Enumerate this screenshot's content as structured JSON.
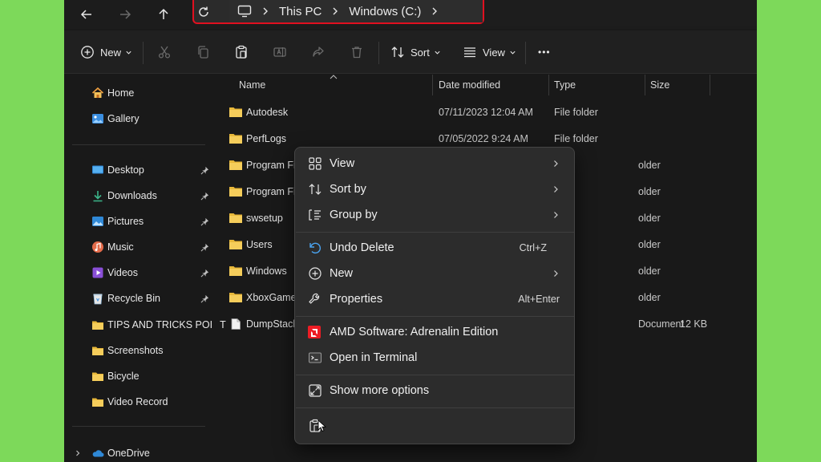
{
  "address": {
    "crumbs": [
      "This PC",
      "Windows (C:)"
    ]
  },
  "toolbar": {
    "new_label": "New",
    "sort_label": "Sort",
    "view_label": "View",
    "more_label": "•••"
  },
  "nav": {
    "items": [
      {
        "label": "Home",
        "icon": "home-icon"
      },
      {
        "label": "Gallery",
        "icon": "gallery-icon"
      },
      {
        "label": "Desktop",
        "icon": "desktop-icon",
        "pinned": true
      },
      {
        "label": "Downloads",
        "icon": "download-icon",
        "pinned": true
      },
      {
        "label": "Pictures",
        "icon": "pictures-icon",
        "pinned": true
      },
      {
        "label": "Music",
        "icon": "music-icon",
        "pinned": true
      },
      {
        "label": "Videos",
        "icon": "videos-icon",
        "pinned": true
      },
      {
        "label": "Recycle Bin",
        "icon": "recycle-bin-icon",
        "pinned": true
      },
      {
        "label": "TIPS AND TRICKS POINT",
        "icon": "folder-icon"
      },
      {
        "label": "Screenshots",
        "icon": "folder-icon"
      },
      {
        "label": "Bicycle",
        "icon": "folder-icon"
      },
      {
        "label": "Video Record",
        "icon": "folder-icon"
      },
      {
        "label": "OneDrive",
        "icon": "onedrive-icon"
      }
    ]
  },
  "columns": {
    "name": "Name",
    "date": "Date modified",
    "type": "Type",
    "size": "Size"
  },
  "files": [
    {
      "name": "Autodesk",
      "date": "07/11/2023 12:04 AM",
      "type": "File folder",
      "size": ""
    },
    {
      "name": "PerfLogs",
      "date": "07/05/2022 9:24 AM",
      "type": "File folder",
      "size": ""
    },
    {
      "name": "Program Fil",
      "date": "",
      "type": "older",
      "size": ""
    },
    {
      "name": "Program Fil",
      "date": "",
      "type": "older",
      "size": ""
    },
    {
      "name": "swsetup",
      "date": "",
      "type": "older",
      "size": ""
    },
    {
      "name": "Users",
      "date": "",
      "type": "older",
      "size": ""
    },
    {
      "name": "Windows",
      "date": "",
      "type": "older",
      "size": ""
    },
    {
      "name": "XboxGames",
      "date": "",
      "type": "older",
      "size": ""
    },
    {
      "name": "DumpStack",
      "date": "",
      "type": "Document",
      "size": "12 KB"
    }
  ],
  "context_menu": {
    "view": "View",
    "sort_by": "Sort by",
    "group_by": "Group by",
    "undo_delete": "Undo Delete",
    "undo_shortcut": "Ctrl+Z",
    "new": "New",
    "properties": "Properties",
    "properties_shortcut": "Alt+Enter",
    "amd": "AMD Software: Adrenalin Edition",
    "terminal": "Open in Terminal",
    "more_options": "Show more options"
  },
  "colors": {
    "page_background": "#7dd95a",
    "highlight_border": "#e01020",
    "folder": "#e8b83a",
    "accent": "#4aa3f0",
    "amd": "#ed1c24"
  }
}
